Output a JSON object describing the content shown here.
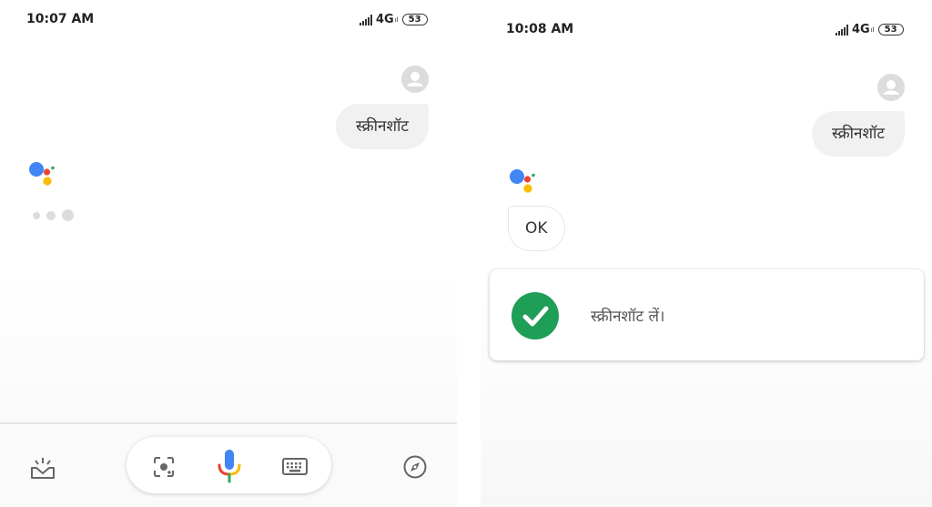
{
  "left_screen": {
    "status_bar": {
      "time": "10:07 AM",
      "network": "4G",
      "network_sub": "ıl",
      "battery": "53"
    },
    "user_query": "स्क्रीनशॉट"
  },
  "right_screen": {
    "status_bar": {
      "time": "10:08 AM",
      "network": "4G",
      "network_sub": "ıl",
      "battery": "53"
    },
    "user_query": "स्क्रीनशॉट",
    "assistant_reply": "OK",
    "action_card": {
      "text": "स्क्रीनशॉट लें।"
    }
  },
  "icons": {
    "signal": "signal-icon",
    "avatar": "account-icon",
    "assistant": "google-assistant-logo",
    "snapshot": "updates-tray-icon",
    "lens": "lens-icon",
    "mic": "mic-icon",
    "keyboard": "keyboard-icon",
    "explore": "explore-compass-icon",
    "check": "check-icon"
  },
  "colors": {
    "google_blue": "#4285F4",
    "google_red": "#EA4335",
    "google_yellow": "#FBBC05",
    "google_green": "#34A853",
    "success_green": "#1e9e57"
  }
}
